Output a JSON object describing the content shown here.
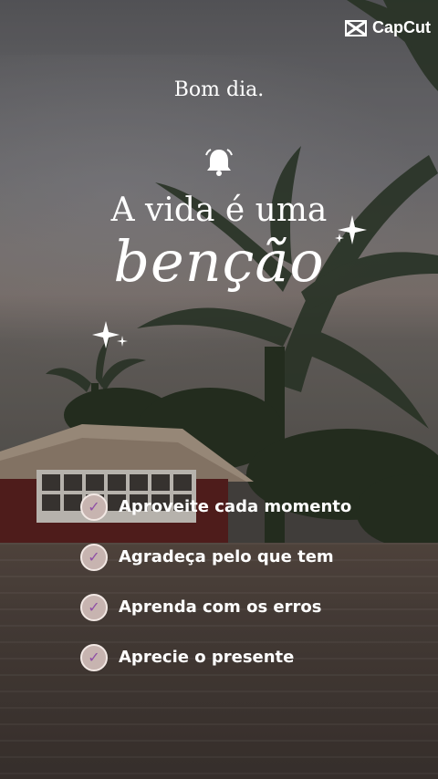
{
  "watermark": {
    "label": "CapCut"
  },
  "greeting": "Bom dia.",
  "headline": "A vida é uma",
  "script_word": "benção",
  "checklist": [
    {
      "label": "Aproveite cada momento",
      "icon": "check-icon"
    },
    {
      "label": "Agradeça pelo que tem",
      "icon": "check-icon"
    },
    {
      "label": "Aprenda com os erros",
      "icon": "check-icon"
    },
    {
      "label": "Aprecie o presente",
      "icon": "check-icon"
    }
  ],
  "colors": {
    "text": "#ffffff",
    "badge": "#c7b4b0",
    "check": "#8f4fa6"
  }
}
